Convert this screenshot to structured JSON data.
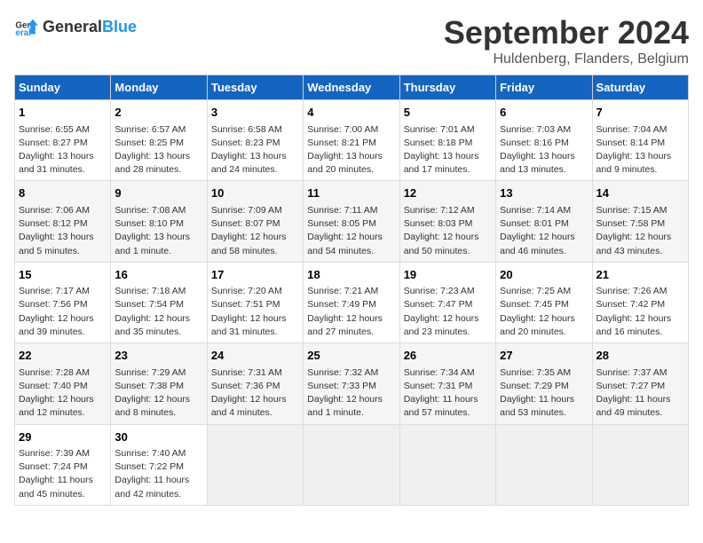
{
  "header": {
    "logo_general": "General",
    "logo_blue": "Blue",
    "title": "September 2024",
    "subtitle": "Huldenberg, Flanders, Belgium"
  },
  "days_of_week": [
    "Sunday",
    "Monday",
    "Tuesday",
    "Wednesday",
    "Thursday",
    "Friday",
    "Saturday"
  ],
  "weeks": [
    [
      {
        "day": "1",
        "lines": [
          "Sunrise: 6:55 AM",
          "Sunset: 8:27 PM",
          "Daylight: 13 hours",
          "and 31 minutes."
        ]
      },
      {
        "day": "2",
        "lines": [
          "Sunrise: 6:57 AM",
          "Sunset: 8:25 PM",
          "Daylight: 13 hours",
          "and 28 minutes."
        ]
      },
      {
        "day": "3",
        "lines": [
          "Sunrise: 6:58 AM",
          "Sunset: 8:23 PM",
          "Daylight: 13 hours",
          "and 24 minutes."
        ]
      },
      {
        "day": "4",
        "lines": [
          "Sunrise: 7:00 AM",
          "Sunset: 8:21 PM",
          "Daylight: 13 hours",
          "and 20 minutes."
        ]
      },
      {
        "day": "5",
        "lines": [
          "Sunrise: 7:01 AM",
          "Sunset: 8:18 PM",
          "Daylight: 13 hours",
          "and 17 minutes."
        ]
      },
      {
        "day": "6",
        "lines": [
          "Sunrise: 7:03 AM",
          "Sunset: 8:16 PM",
          "Daylight: 13 hours",
          "and 13 minutes."
        ]
      },
      {
        "day": "7",
        "lines": [
          "Sunrise: 7:04 AM",
          "Sunset: 8:14 PM",
          "Daylight: 13 hours",
          "and 9 minutes."
        ]
      }
    ],
    [
      {
        "day": "8",
        "lines": [
          "Sunrise: 7:06 AM",
          "Sunset: 8:12 PM",
          "Daylight: 13 hours",
          "and 5 minutes."
        ]
      },
      {
        "day": "9",
        "lines": [
          "Sunrise: 7:08 AM",
          "Sunset: 8:10 PM",
          "Daylight: 13 hours",
          "and 1 minute."
        ]
      },
      {
        "day": "10",
        "lines": [
          "Sunrise: 7:09 AM",
          "Sunset: 8:07 PM",
          "Daylight: 12 hours",
          "and 58 minutes."
        ]
      },
      {
        "day": "11",
        "lines": [
          "Sunrise: 7:11 AM",
          "Sunset: 8:05 PM",
          "Daylight: 12 hours",
          "and 54 minutes."
        ]
      },
      {
        "day": "12",
        "lines": [
          "Sunrise: 7:12 AM",
          "Sunset: 8:03 PM",
          "Daylight: 12 hours",
          "and 50 minutes."
        ]
      },
      {
        "day": "13",
        "lines": [
          "Sunrise: 7:14 AM",
          "Sunset: 8:01 PM",
          "Daylight: 12 hours",
          "and 46 minutes."
        ]
      },
      {
        "day": "14",
        "lines": [
          "Sunrise: 7:15 AM",
          "Sunset: 7:58 PM",
          "Daylight: 12 hours",
          "and 43 minutes."
        ]
      }
    ],
    [
      {
        "day": "15",
        "lines": [
          "Sunrise: 7:17 AM",
          "Sunset: 7:56 PM",
          "Daylight: 12 hours",
          "and 39 minutes."
        ]
      },
      {
        "day": "16",
        "lines": [
          "Sunrise: 7:18 AM",
          "Sunset: 7:54 PM",
          "Daylight: 12 hours",
          "and 35 minutes."
        ]
      },
      {
        "day": "17",
        "lines": [
          "Sunrise: 7:20 AM",
          "Sunset: 7:51 PM",
          "Daylight: 12 hours",
          "and 31 minutes."
        ]
      },
      {
        "day": "18",
        "lines": [
          "Sunrise: 7:21 AM",
          "Sunset: 7:49 PM",
          "Daylight: 12 hours",
          "and 27 minutes."
        ]
      },
      {
        "day": "19",
        "lines": [
          "Sunrise: 7:23 AM",
          "Sunset: 7:47 PM",
          "Daylight: 12 hours",
          "and 23 minutes."
        ]
      },
      {
        "day": "20",
        "lines": [
          "Sunrise: 7:25 AM",
          "Sunset: 7:45 PM",
          "Daylight: 12 hours",
          "and 20 minutes."
        ]
      },
      {
        "day": "21",
        "lines": [
          "Sunrise: 7:26 AM",
          "Sunset: 7:42 PM",
          "Daylight: 12 hours",
          "and 16 minutes."
        ]
      }
    ],
    [
      {
        "day": "22",
        "lines": [
          "Sunrise: 7:28 AM",
          "Sunset: 7:40 PM",
          "Daylight: 12 hours",
          "and 12 minutes."
        ]
      },
      {
        "day": "23",
        "lines": [
          "Sunrise: 7:29 AM",
          "Sunset: 7:38 PM",
          "Daylight: 12 hours",
          "and 8 minutes."
        ]
      },
      {
        "day": "24",
        "lines": [
          "Sunrise: 7:31 AM",
          "Sunset: 7:36 PM",
          "Daylight: 12 hours",
          "and 4 minutes."
        ]
      },
      {
        "day": "25",
        "lines": [
          "Sunrise: 7:32 AM",
          "Sunset: 7:33 PM",
          "Daylight: 12 hours",
          "and 1 minute."
        ]
      },
      {
        "day": "26",
        "lines": [
          "Sunrise: 7:34 AM",
          "Sunset: 7:31 PM",
          "Daylight: 11 hours",
          "and 57 minutes."
        ]
      },
      {
        "day": "27",
        "lines": [
          "Sunrise: 7:35 AM",
          "Sunset: 7:29 PM",
          "Daylight: 11 hours",
          "and 53 minutes."
        ]
      },
      {
        "day": "28",
        "lines": [
          "Sunrise: 7:37 AM",
          "Sunset: 7:27 PM",
          "Daylight: 11 hours",
          "and 49 minutes."
        ]
      }
    ],
    [
      {
        "day": "29",
        "lines": [
          "Sunrise: 7:39 AM",
          "Sunset: 7:24 PM",
          "Daylight: 11 hours",
          "and 45 minutes."
        ]
      },
      {
        "day": "30",
        "lines": [
          "Sunrise: 7:40 AM",
          "Sunset: 7:22 PM",
          "Daylight: 11 hours",
          "and 42 minutes."
        ]
      },
      {
        "day": "",
        "lines": []
      },
      {
        "day": "",
        "lines": []
      },
      {
        "day": "",
        "lines": []
      },
      {
        "day": "",
        "lines": []
      },
      {
        "day": "",
        "lines": []
      }
    ]
  ]
}
